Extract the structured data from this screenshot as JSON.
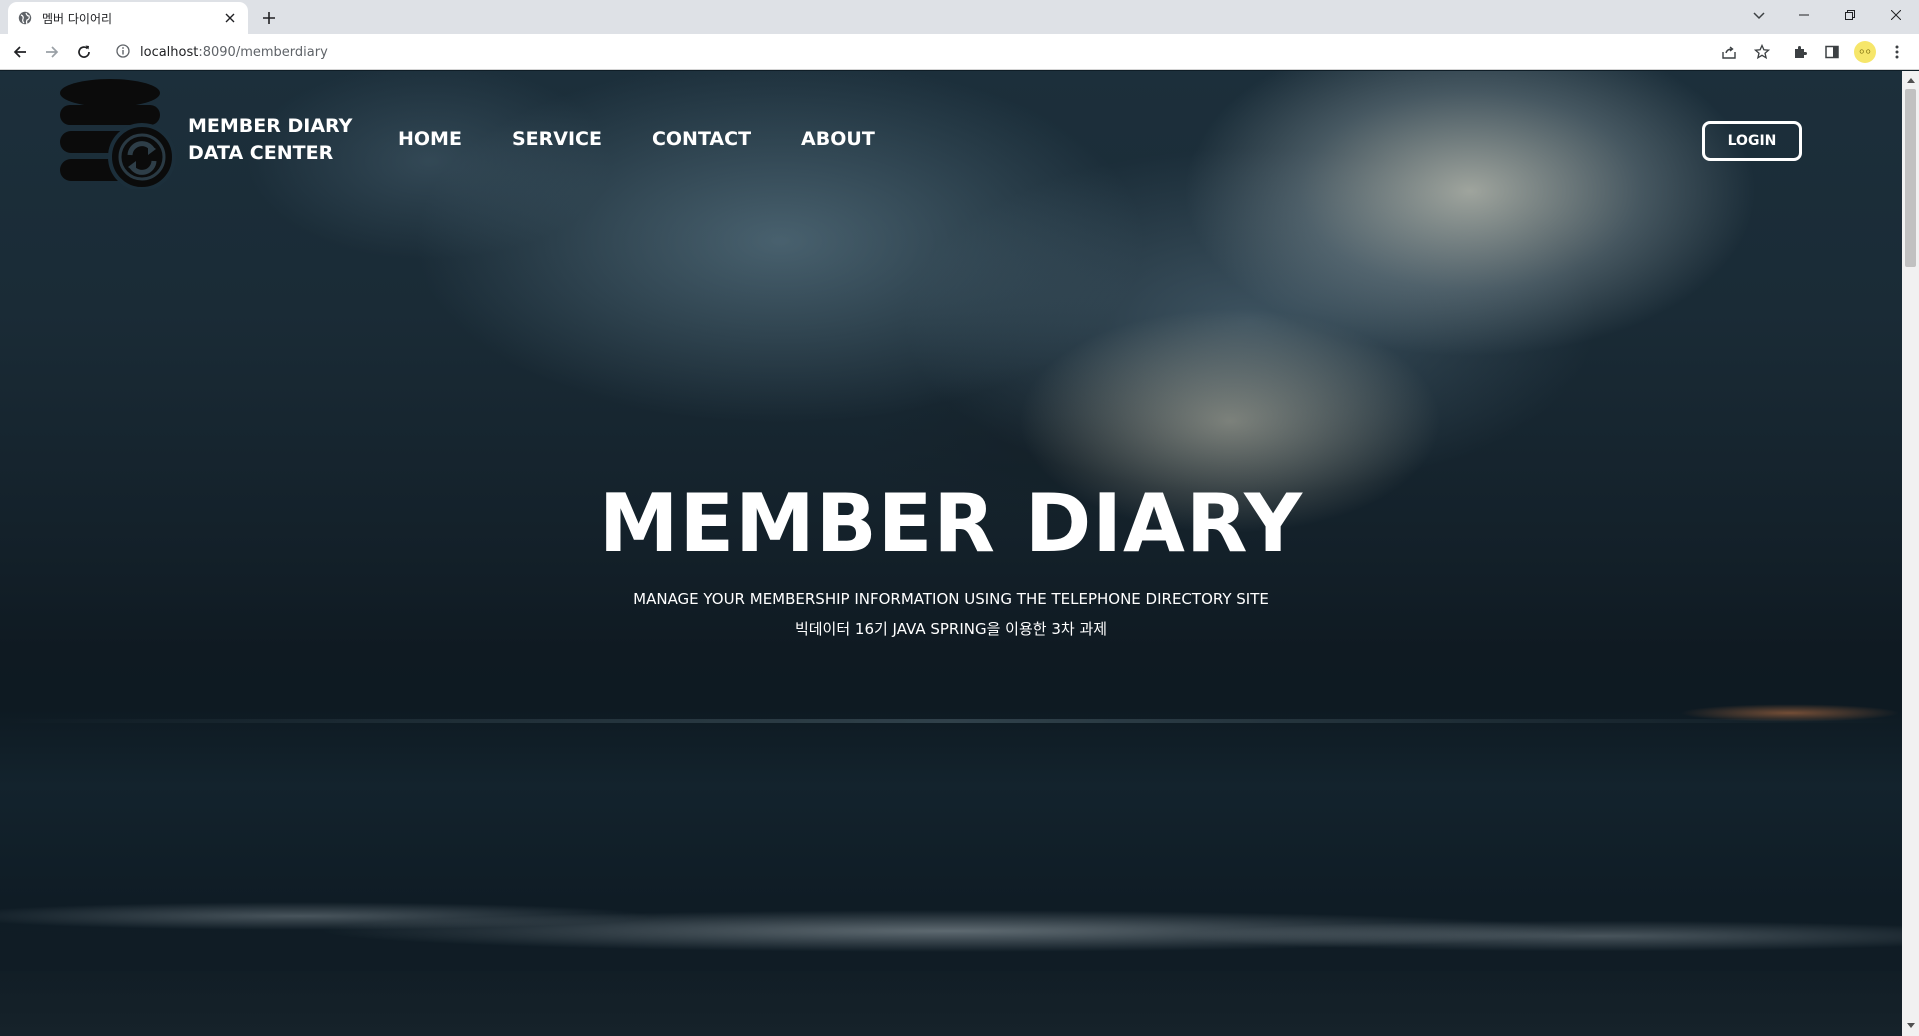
{
  "browser": {
    "tab_title": "멤버 다이어리",
    "url_host": "localhost",
    "url_rest": ":8090/memberdiary",
    "profile_label": "ㅇㅇ"
  },
  "header": {
    "brand_line1": "MEMBER DIARY",
    "brand_line2": "DATA CENTER",
    "nav": [
      "HOME",
      "SERVICE",
      "CONTACT",
      "ABOUT"
    ],
    "login_label": "LOGIN"
  },
  "hero": {
    "title": "MEMBER DIARY",
    "subtitle": "MANAGE YOUR MEMBERSHIP INFORMATION USING THE TELEPHONE DIRECTORY SITE",
    "subtitle_ko": "빅데이터 16기 JAVA SPRING을 이용한 3차 과제"
  },
  "colors": {
    "header_text": "#ffffff",
    "logo": "#0b0b0b",
    "chrome_bg": "#dee1e6"
  }
}
